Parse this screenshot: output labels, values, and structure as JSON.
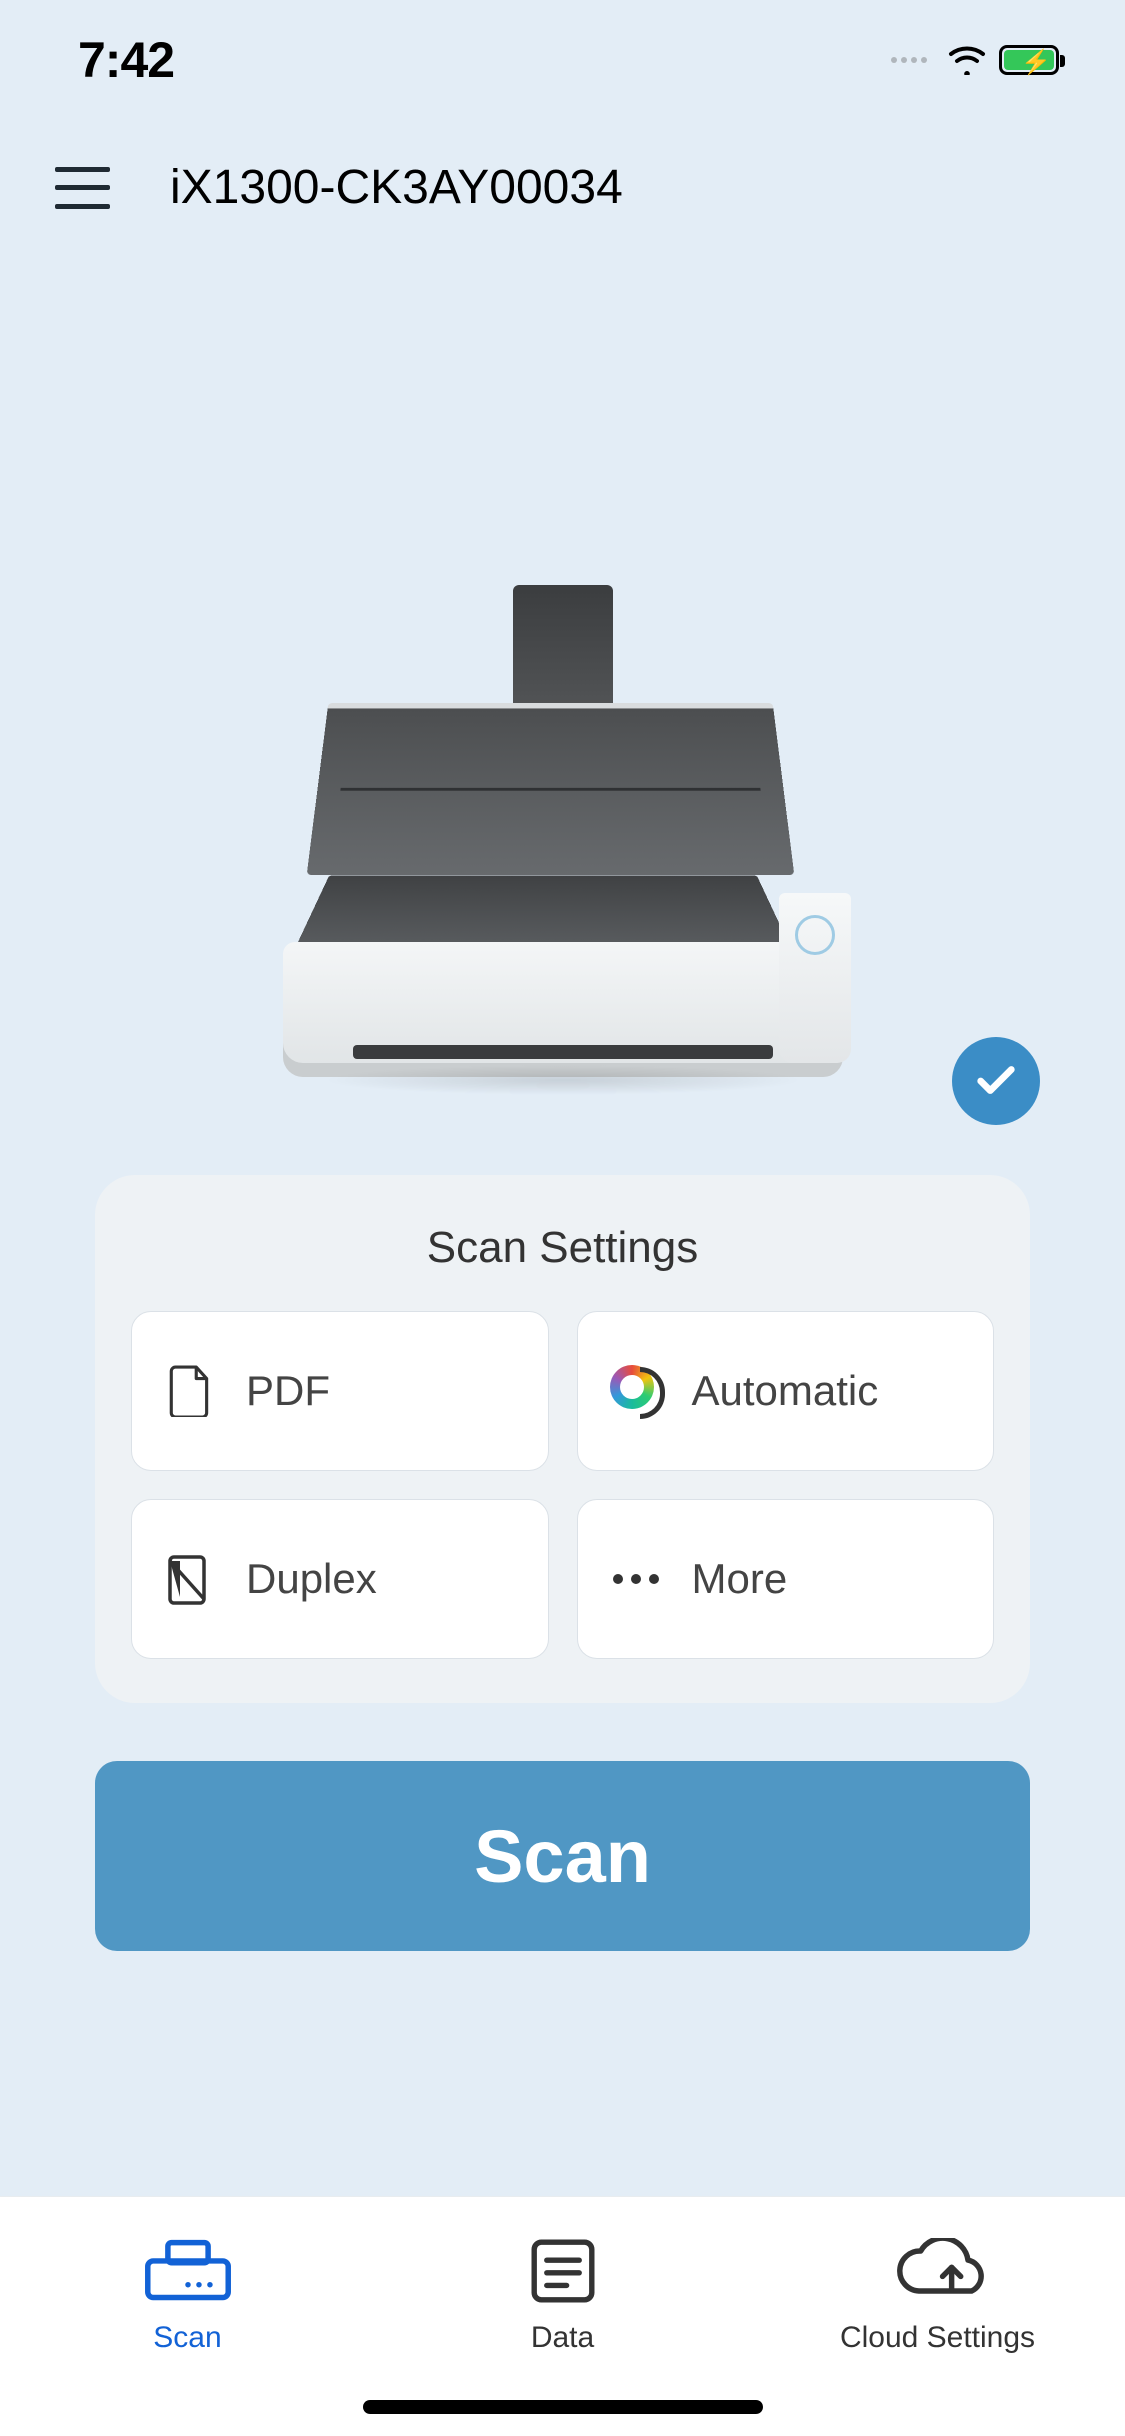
{
  "status_bar": {
    "time": "7:42"
  },
  "header": {
    "device_name": "iX1300-CK3AY00034"
  },
  "scanner": {
    "connected_icon": "check-icon"
  },
  "settings": {
    "title": "Scan Settings",
    "items": [
      {
        "icon": "document-icon",
        "label": "PDF"
      },
      {
        "icon": "color-wheel-icon",
        "label": "Automatic"
      },
      {
        "icon": "duplex-icon",
        "label": "Duplex"
      },
      {
        "icon": "more-icon",
        "label": "More"
      }
    ]
  },
  "scan_button": {
    "label": "Scan"
  },
  "tabs": [
    {
      "icon": "scanner-tab-icon",
      "label": "Scan",
      "active": true
    },
    {
      "icon": "data-tab-icon",
      "label": "Data",
      "active": false
    },
    {
      "icon": "cloud-settings-tab-icon",
      "label": "Cloud Settings",
      "active": false
    }
  ],
  "colors": {
    "background": "#e3edf6",
    "primary_button": "#5097c4",
    "accent": "#1262d6",
    "status_ok": "#3b8dc6"
  }
}
